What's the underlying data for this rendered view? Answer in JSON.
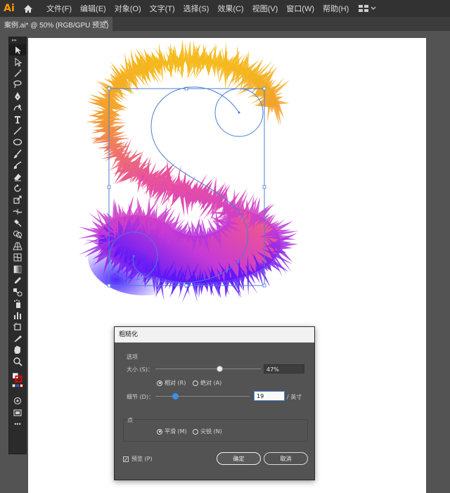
{
  "app": {
    "logo": "Ai"
  },
  "menubar": {
    "items": [
      "文件(F)",
      "编辑(E)",
      "对象(O)",
      "文字(T)",
      "选择(S)",
      "效果(C)",
      "视图(V)",
      "窗口(W)",
      "帮助(H)"
    ]
  },
  "tab": {
    "title": "案例.ai* @ 50% (RGB/GPU 预览)",
    "close": "×"
  },
  "toolbar": {
    "header": "▸▸",
    "tools": [
      "selection-tool",
      "direct-selection-tool",
      "magic-wand-tool",
      "lasso-tool",
      "pen-tool",
      "curvature-tool",
      "type-tool",
      "line-tool",
      "ellipse-tool",
      "paintbrush-tool",
      "shaper-tool",
      "eraser-tool",
      "rotate-tool",
      "scale-tool",
      "width-tool",
      "puppet-warp-tool",
      "shape-builder-tool",
      "perspective-grid-tool",
      "mesh-tool",
      "gradient-tool",
      "eyedropper-tool",
      "blend-tool",
      "symbol-sprayer-tool",
      "column-graph-tool",
      "artboard-tool",
      "slice-tool",
      "hand-tool",
      "zoom-tool"
    ],
    "more": "•••"
  },
  "dialog": {
    "title": "粗糙化",
    "options_label": "选项",
    "size_label": "大小 (S)：",
    "size_value": "47%",
    "size_fraction": 0.47,
    "relative_label": "相对 (R)",
    "absolute_label": "绝对 (A)",
    "detail_label": "细节 (D)：",
    "detail_value": "19",
    "detail_unit": "/ 英寸",
    "points_label": "点",
    "smooth_label": "平滑 (M)",
    "corner_label": "尖锐 (N)",
    "preview_label": "预览 (P)",
    "preview_checked": true,
    "ok_label": "确定",
    "cancel_label": "取消"
  },
  "colors": {
    "accent_orange": "#ff9a00",
    "gradient_top": "#f5b21a",
    "gradient_mid": "#e44db0",
    "gradient_bottom": "#5a1cff",
    "selection_blue": "#4a7fd4",
    "detail_thumb": "#3d8fe8"
  }
}
